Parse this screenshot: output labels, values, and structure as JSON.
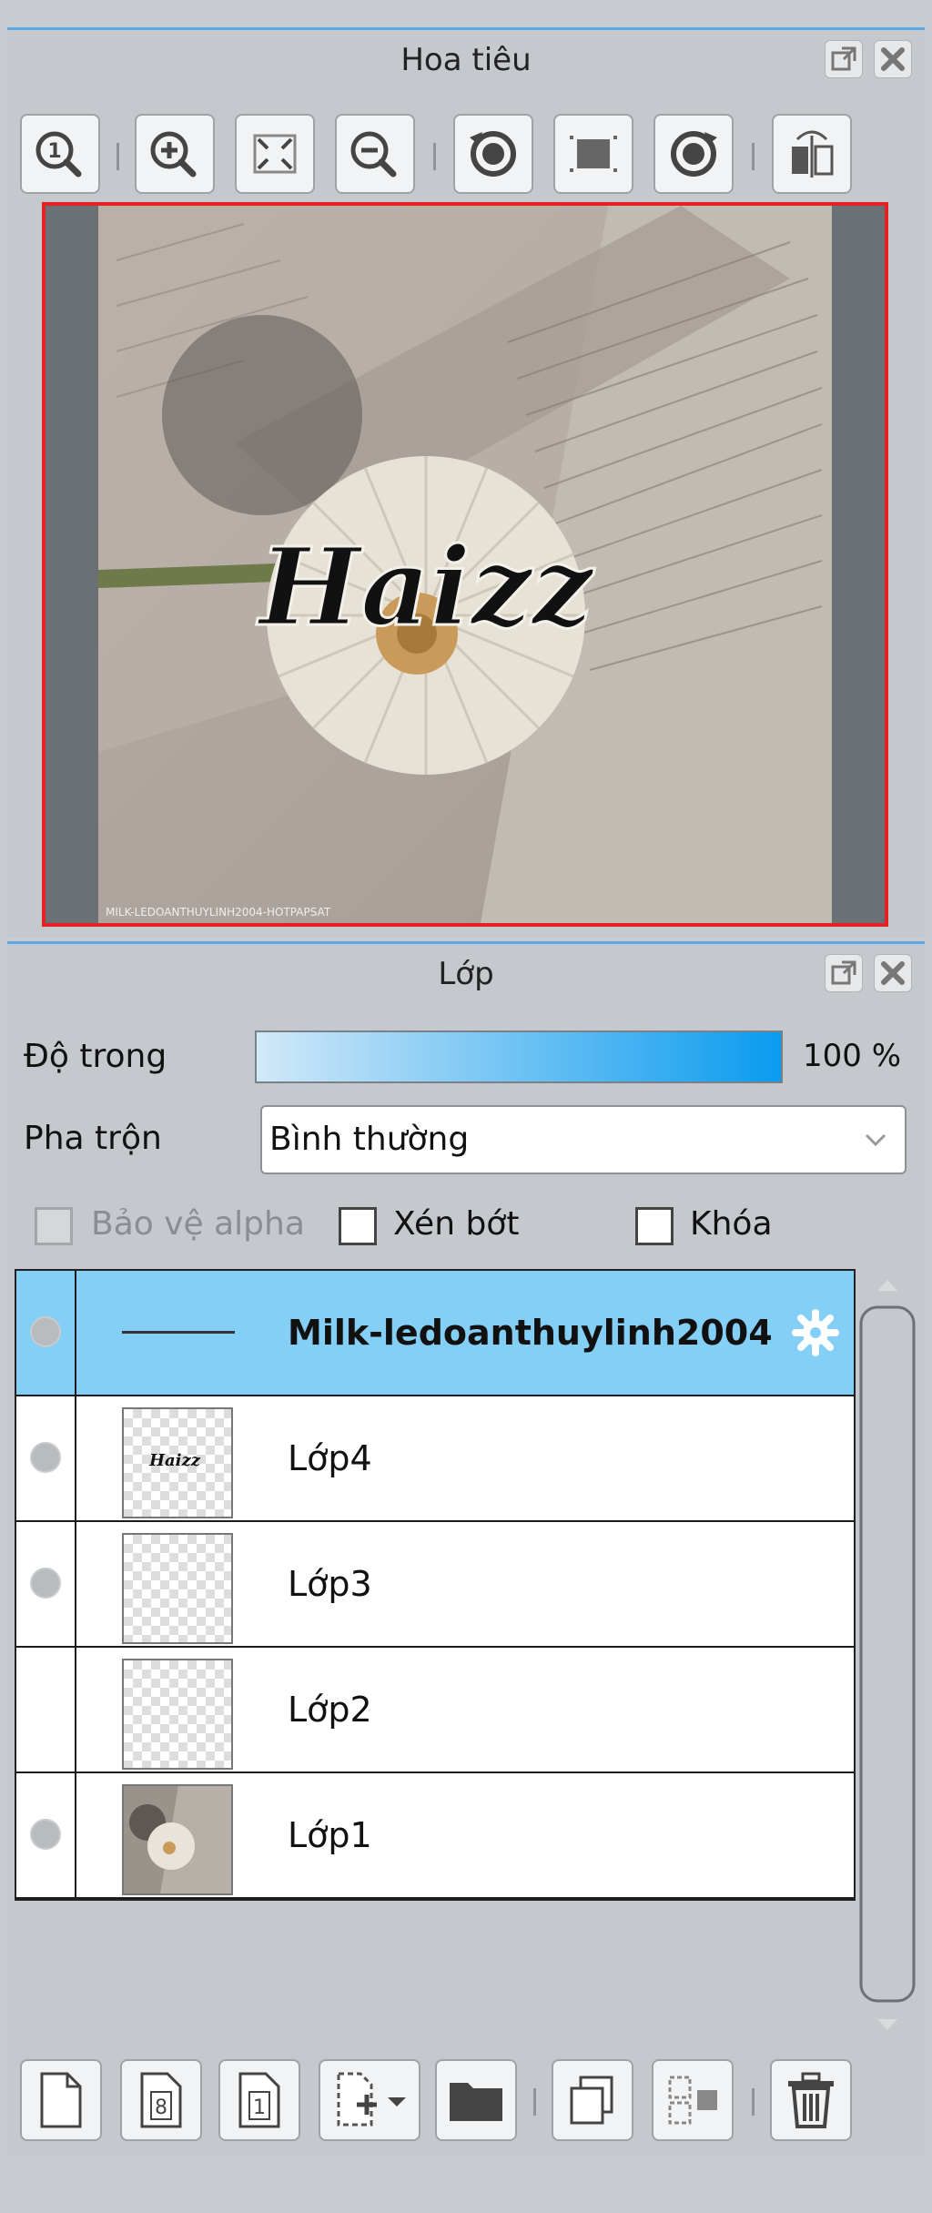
{
  "navigator": {
    "title": "Hoa tiêu",
    "toolbar": [
      {
        "name": "zoom-actual-size-icon"
      },
      {
        "name": "zoom-in-icon"
      },
      {
        "name": "fit-to-screen-icon"
      },
      {
        "name": "zoom-out-icon"
      },
      {
        "name": "rotate-left-icon"
      },
      {
        "name": "reset-rotation-icon"
      },
      {
        "name": "rotate-right-icon"
      },
      {
        "name": "flip-horizontal-icon"
      }
    ],
    "preview": {
      "caption_text": "Haizz",
      "watermark_text": "MILK-LEDOANTHUYLINH2004-HOTPAPSAT"
    }
  },
  "layers": {
    "title": "Lớp",
    "opacity_label": "Độ trong",
    "opacity_value": "100 %",
    "opacity_fraction": 1.0,
    "blend_label": "Pha trộn",
    "blend_value": "Bình thường",
    "checkboxes": {
      "protect_alpha": "Bảo vệ alpha",
      "clip": "Xén bớt",
      "lock": "Khóa"
    },
    "items": [
      {
        "name": "Milk-ledoanthuylinh2004",
        "selected": true,
        "visible_dot": true
      },
      {
        "name": "Lớp4",
        "selected": false,
        "visible_dot": true
      },
      {
        "name": "Lớp3",
        "selected": false,
        "visible_dot": true
      },
      {
        "name": "Lớp2",
        "selected": false,
        "visible_dot": false
      },
      {
        "name": "Lớp1",
        "selected": false,
        "visible_dot": true
      }
    ],
    "thumb_text": "Haizz"
  },
  "colors": {
    "accent_blue": "#5aa9e6",
    "selection": "#84cff5",
    "preview_border": "#e32222"
  }
}
